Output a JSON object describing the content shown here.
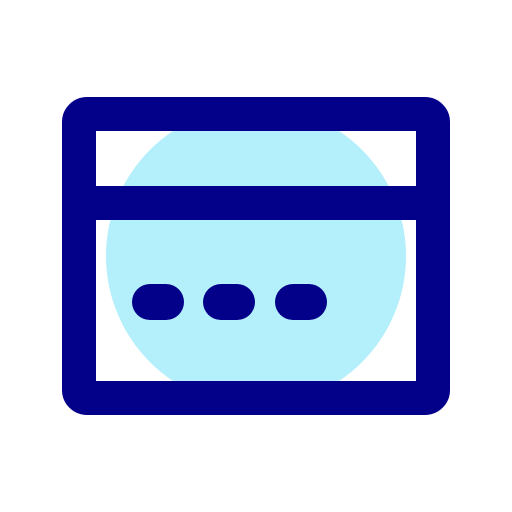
{
  "icon": {
    "name": "browser-window-icon",
    "colors": {
      "background": "#ffffff",
      "outline": "#03008a",
      "accent_circle": "#b3f0fb"
    },
    "parts": [
      "window-frame",
      "title-bar-divider",
      "accent-circle",
      "more-dots"
    ]
  }
}
